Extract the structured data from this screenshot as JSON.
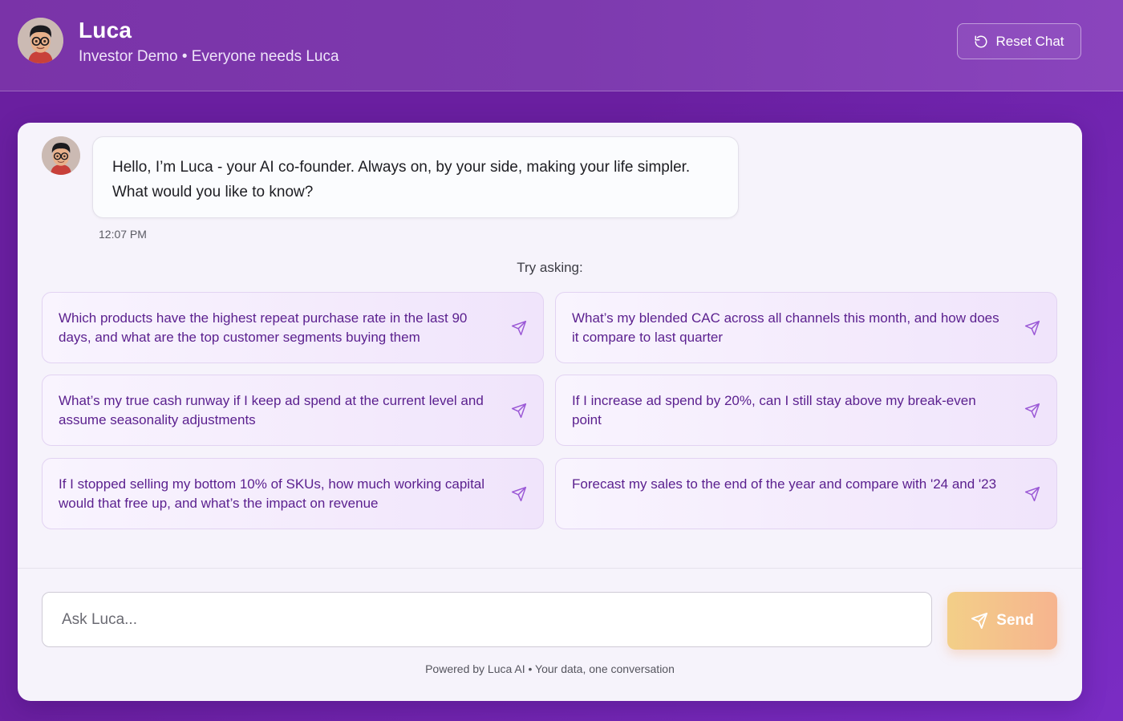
{
  "header": {
    "title": "Luca",
    "subtitle": "Investor Demo • Everyone needs Luca",
    "reset_label": "Reset Chat"
  },
  "chat": {
    "message_line1": "Hello, I’m Luca - your AI co-founder. Always on, by your side, making your life simpler.",
    "message_line2": "What would you like to know?",
    "timestamp": "12:07 PM",
    "try_asking": "Try asking:"
  },
  "suggestions": [
    "Which products have the highest repeat purchase rate in the last 90 days, and what are the top customer segments buying them",
    "What’s my blended CAC across all channels this month, and how does it compare to last quarter",
    "What’s my true cash runway if I keep ad spend at the current level and assume seasonality adjustments",
    "If I increase ad spend by 20%, can I still stay above my break-even point",
    "If I stopped selling my bottom 10% of SKUs, how much working capital would that free up, and what’s the impact on revenue",
    "Forecast my sales to the end of the year and compare with '24 and '23"
  ],
  "composer": {
    "placeholder": "Ask Luca...",
    "value": "",
    "send_label": "Send"
  },
  "footer": {
    "note": "Powered by Luca AI • Your data, one conversation"
  },
  "icons": {
    "reset": "rotate-ccw-icon",
    "suggestion_send": "paper-plane-icon",
    "send": "paper-plane-icon"
  },
  "colors": {
    "brand_purple": "#6a1fa0",
    "suggestion_text": "#5a1f8e",
    "send_button_start": "#f3cf88",
    "send_button_end": "#f6b48f"
  }
}
